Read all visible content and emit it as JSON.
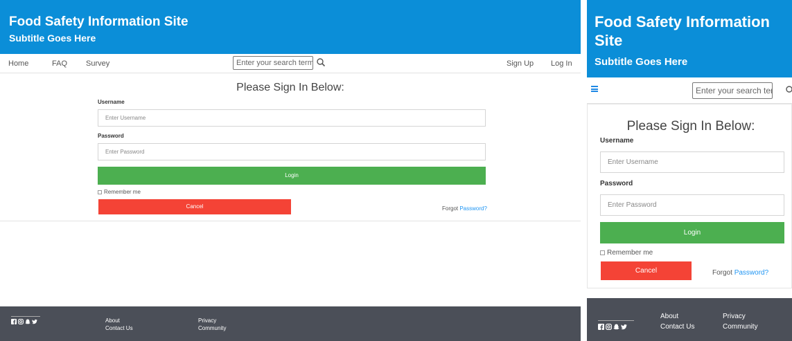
{
  "site": {
    "title": "Food Safety Information Site",
    "subtitle": "Subtitle Goes Here"
  },
  "nav": {
    "home": "Home",
    "faq": "FAQ",
    "survey": "Survey",
    "search_placeholder": "Enter your search term...",
    "search_placeholder_mobile": "Enter your search ter",
    "sign_up": "Sign Up",
    "log_in": "Log In"
  },
  "login": {
    "heading": "Please Sign In Below:",
    "username_label": "Username",
    "username_placeholder": "Enter Username",
    "password_label": "Password",
    "password_placeholder": "Enter Password",
    "login_button": "Login",
    "remember_me": "Remember me",
    "cancel_button": "Cancel",
    "forgot_prefix": "Forgot ",
    "forgot_link": "Password?"
  },
  "footer": {
    "about": "About",
    "contact": "Contact Us",
    "privacy": "Privacy",
    "community": "Community",
    "social_icons": [
      "facebook-icon",
      "instagram-icon",
      "snapchat-icon",
      "twitter-icon"
    ]
  },
  "colors": {
    "header": "#0b8ed8",
    "login": "#4caf50",
    "cancel": "#f44336",
    "footer": "#4b4f58",
    "link": "#2196f3"
  }
}
